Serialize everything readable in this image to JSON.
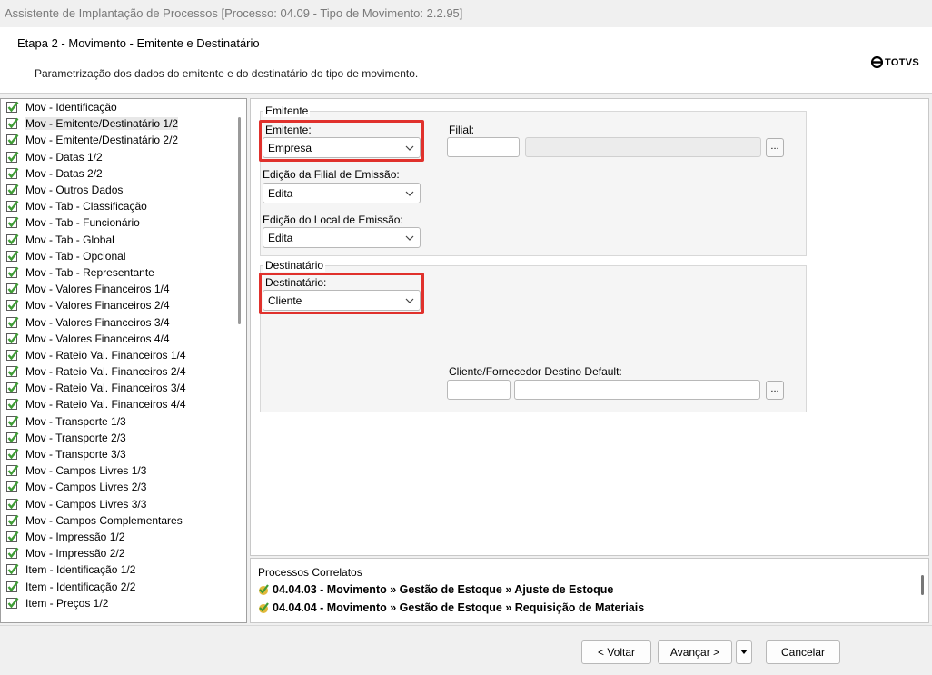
{
  "window": {
    "title": "Assistente de Implantação de Processos [Processo: 04.09 - Tipo de Movimento: 2.2.95]"
  },
  "header": {
    "step_title": "Etapa 2 - Movimento - Emitente e Destinatário",
    "description": "Parametrização dos dados do emitente e do destinatário do tipo de movimento.",
    "logo_text": "TOTVS"
  },
  "tree": {
    "selected_index": 1,
    "items": [
      "Mov - Identificação",
      "Mov - Emitente/Destinatário 1/2",
      "Mov - Emitente/Destinatário 2/2",
      "Mov - Datas 1/2",
      "Mov - Datas 2/2",
      "Mov - Outros Dados",
      "Mov - Tab - Classificação",
      "Mov - Tab - Funcionário",
      "Mov - Tab - Global",
      "Mov - Tab - Opcional",
      "Mov - Tab - Representante",
      "Mov - Valores Financeiros 1/4",
      "Mov - Valores Financeiros 2/4",
      "Mov - Valores Financeiros 3/4",
      "Mov - Valores Financeiros 4/4",
      "Mov - Rateio Val. Financeiros 1/4",
      "Mov - Rateio Val. Financeiros 2/4",
      "Mov - Rateio Val. Financeiros 3/4",
      "Mov - Rateio Val. Financeiros 4/4",
      "Mov - Transporte 1/3",
      "Mov - Transporte 2/3",
      "Mov - Transporte 3/3",
      "Mov - Campos Livres 1/3",
      "Mov - Campos Livres 2/3",
      "Mov - Campos Livres 3/3",
      "Mov - Campos Complementares",
      "Mov - Impressão 1/2",
      "Mov - Impressão 2/2",
      "Item - Identificação 1/2",
      "Item - Identificação 2/2",
      "Item - Preços 1/2"
    ]
  },
  "emitente": {
    "group_title": "Emitente",
    "emitente_label": "Emitente:",
    "emitente_value": "Empresa",
    "filial_label": "Filial:",
    "filial_code": "",
    "filial_name": "",
    "filial_lookup": "...",
    "edicao_filial_label": "Edição da Filial de Emissão:",
    "edicao_filial_value": "Edita",
    "edicao_local_label": "Edição do Local de Emissão:",
    "edicao_local_value": "Edita"
  },
  "destinatario": {
    "group_title": "Destinatário",
    "destinatario_label": "Destinatário:",
    "destinatario_value": "Cliente",
    "cliente_default_label": "Cliente/Fornecedor Destino Default:",
    "cliente_code": "",
    "cliente_name": "",
    "cliente_lookup": "..."
  },
  "correlatos": {
    "title": "Processos Correlatos",
    "items": [
      "04.04.03 - Movimento » Gestão de Estoque » Ajuste de Estoque",
      "04.04.04 - Movimento » Gestão de Estoque » Requisição de Materiais"
    ]
  },
  "footer": {
    "back_label": "< Voltar",
    "next_label": "Avançar >",
    "cancel_label": "Cancelar"
  },
  "colors": {
    "highlight": "#e0312c",
    "check_green": "#3f9c35"
  }
}
